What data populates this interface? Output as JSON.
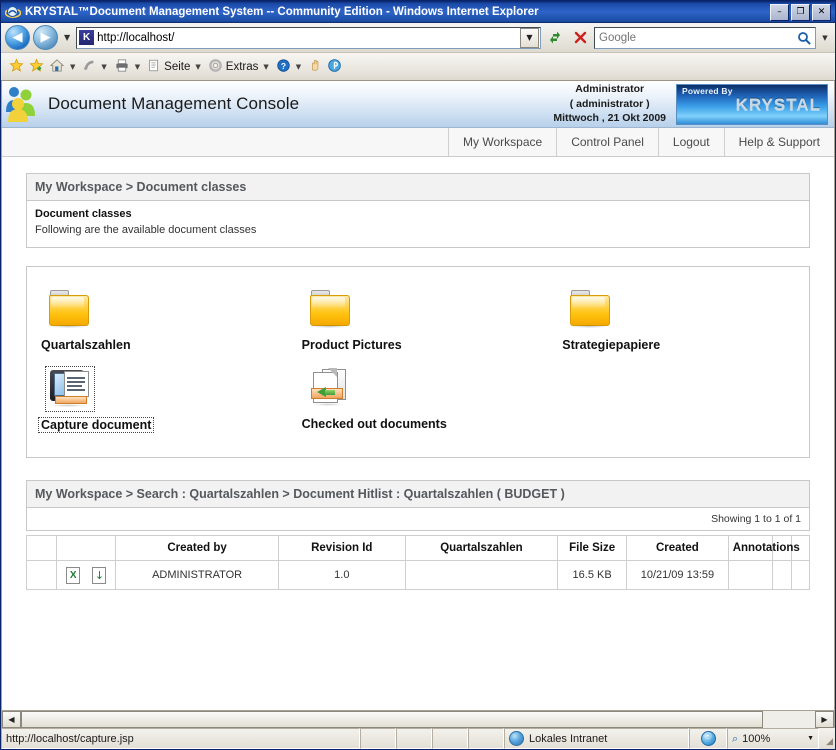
{
  "window": {
    "title": "KRYSTAL™Document Management System -- Community Edition - Windows Internet Explorer",
    "icon": "ie-logo-icon",
    "minimize": "–",
    "maximize": "❐",
    "close": "✕"
  },
  "browser": {
    "back": "◀",
    "forward": "▶",
    "history_caret": "▼",
    "address": {
      "favicon_letter": "K",
      "value": "http://localhost/",
      "dropdown_caret": "▼"
    },
    "refresh": "↺",
    "stop": "✕",
    "search": {
      "placeholder": "Google",
      "value": "",
      "go_icon": "⌕",
      "caret": "▼"
    },
    "command_bar": [
      {
        "label": "",
        "icon": "favorites-star-icon",
        "glyph": "★",
        "caret": false
      },
      {
        "label": "",
        "icon": "add-favorite-icon",
        "glyph": "★",
        "caret": false
      },
      {
        "label": "",
        "icon": "home-icon",
        "glyph": "⌂",
        "caret": true
      },
      {
        "label": "",
        "icon": "feeds-icon",
        "glyph": "◠",
        "caret": true
      },
      {
        "label": "",
        "icon": "print-icon",
        "glyph": "⎙",
        "caret": true
      },
      {
        "label": "Seite",
        "icon": "page-icon",
        "glyph": "☰",
        "caret": true
      },
      {
        "label": "Extras",
        "icon": "tools-gear-icon",
        "glyph": "⚙",
        "caret": true
      },
      {
        "label": "",
        "icon": "help-icon",
        "glyph": "?",
        "caret": true
      },
      {
        "label": "",
        "icon": "hand-icon",
        "glyph": "✋",
        "caret": false
      },
      {
        "label": "",
        "icon": "plugin-icon",
        "glyph": "Ⓟ",
        "caret": false
      }
    ]
  },
  "app": {
    "banner": {
      "logo": "people-group-icon",
      "title": "Document Management Console",
      "user_role": "Administrator",
      "user_name": "( administrator )",
      "date": "Mittwoch , 21 Okt 2009",
      "powered_by_label": "Powered By",
      "brand": "KRYSTAL"
    },
    "nav_tabs": [
      {
        "label": "My Workspace"
      },
      {
        "label": "Control Panel"
      },
      {
        "label": "Logout"
      },
      {
        "label": "Help & Support"
      }
    ],
    "doc_classes_panel": {
      "breadcrumb": "My Workspace > Document classes",
      "heading": "Document classes",
      "subheading": "Following are the available document classes"
    },
    "items": [
      {
        "label": "Quartalszahlen",
        "icon": "folder-icon",
        "type": "folder",
        "focused": false
      },
      {
        "label": "Product Pictures",
        "icon": "folder-icon",
        "type": "folder",
        "focused": false
      },
      {
        "label": "Strategiepapiere",
        "icon": "folder-icon",
        "type": "folder",
        "focused": false
      },
      {
        "label": "Capture document",
        "icon": "scanner-capture-icon",
        "type": "capture",
        "focused": true
      },
      {
        "label": "Checked out documents",
        "icon": "checked-out-documents-icon",
        "type": "checkedout",
        "focused": false
      }
    ],
    "hitlist": {
      "breadcrumb": "My Workspace > Search : Quartalszahlen > Document Hitlist : Quartalszahlen ( BUDGET )",
      "showing": "Showing 1 to 1 of 1",
      "columns": [
        "",
        "",
        "Created by",
        "Revision Id",
        "Quartalszahlen",
        "File Size",
        "Created",
        "Annotations",
        "",
        ""
      ],
      "rows": [
        {
          "open_icon": "open-excel-document-icon",
          "download_icon": "download-document-icon",
          "created_by": "ADMINISTRATOR",
          "revision_id": "1.0",
          "doc_class_value": "",
          "file_size": "16.5 KB",
          "created": "10/21/09 13:59",
          "annotations": "",
          "extra1": "",
          "extra2": ""
        }
      ]
    }
  },
  "scrollbar": {
    "left_arrow": "◀",
    "right_arrow": "▶"
  },
  "statusbar": {
    "url": "http://localhost/capture.jsp",
    "zone_icon": "intranet-globe-icon",
    "zone": "Lokales Intranet",
    "privacy_icon": "privacy-report-icon",
    "zoom_icon": "zoom-magnifier-icon",
    "zoom": "100%",
    "zoom_caret": "▼",
    "resize_grip": "◢"
  },
  "colors": {
    "titlebar": "#1b4aa8",
    "brand_blue": "#3ba0e8",
    "folder_yellow": "#ffc20e",
    "panel_border": "#c8c8c8",
    "accent_orange": "#f0a55c"
  }
}
